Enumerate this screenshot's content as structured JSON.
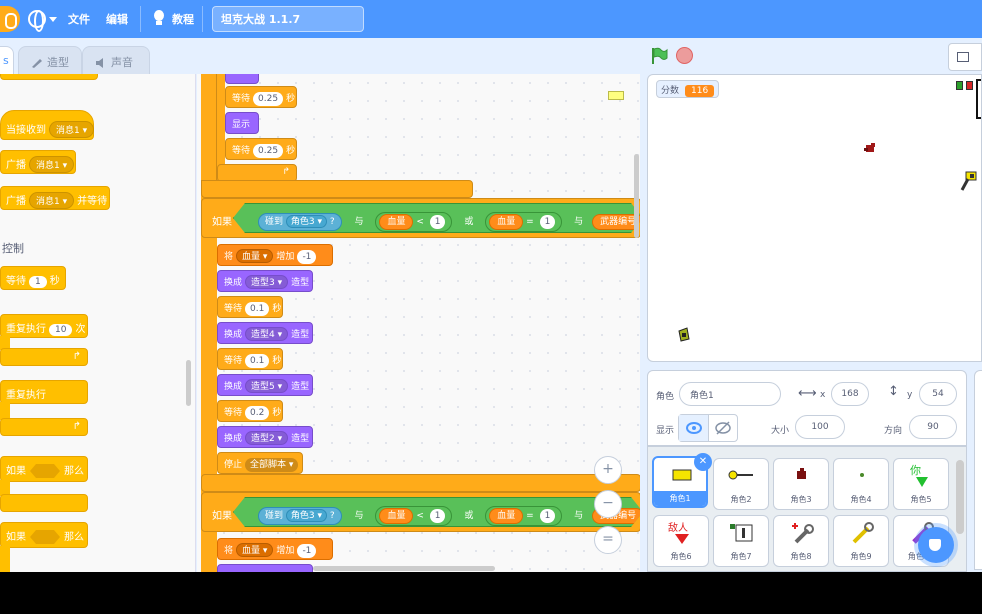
{
  "menubar": {
    "file_label": "文件",
    "edit_label": "编辑",
    "tutorials_label": "教程",
    "project_title": "坦克大战 1.1.7"
  },
  "tabs": {
    "code_label": "s",
    "costumes_label": "造型",
    "sounds_label": "声音"
  },
  "palette": {
    "when_receive": "当接收到",
    "when_receive_msg": "消息1",
    "broadcast": "广播",
    "broadcast_msg": "消息1",
    "broadcast_wait": "广播",
    "broadcast_wait_msg": "消息1",
    "broadcast_wait_suffix": "并等待",
    "category_control": "控制",
    "wait": "等待",
    "wait_value": "1",
    "wait_unit": "秒",
    "repeat": "重复执行",
    "repeat_value": "10",
    "repeat_unit": "次",
    "forever": "重复执行",
    "if_then_1_if": "如果",
    "if_then_1_then": "那么",
    "if_then_2_if": "如果",
    "if_then_2_then": "那么"
  },
  "script": {
    "top_wait1": "等待",
    "top_wait1_val": "0.25",
    "top_wait1_unit": "秒",
    "top_show": "显示",
    "top_wait2": "等待",
    "top_wait2_val": "0.25",
    "top_wait2_unit": "秒",
    "if1": {
      "if": "如果",
      "touching": "碰到",
      "touching_target": "角色3",
      "q": "?",
      "and1": "与",
      "hp1": "血量",
      "lt": "<",
      "lt_val": "1",
      "or": "或",
      "hp2": "血量",
      "eq": "=",
      "eq_val": "1",
      "and2": "与",
      "weapon": "武器编号"
    },
    "change_prefix": "将",
    "change_var": "血量",
    "change_mid": "增加",
    "change_val": "-1",
    "costume_switch": "换成",
    "costume_suffix": "造型",
    "costume3": "造型3",
    "costume4": "造型4",
    "costume5": "造型5",
    "costume2": "造型2",
    "wait": "等待",
    "wait_a": "0.1",
    "wait_b": "0.1",
    "wait_c": "0.2",
    "sec": "秒",
    "stop": "停止",
    "stop_opt": "全部脚本",
    "if2": {
      "if": "如果",
      "touching": "碰到",
      "touching_target": "角色3",
      "q": "?",
      "and1": "与",
      "hp1": "血量",
      "lt": "<",
      "lt_val": "1",
      "or": "或",
      "hp2": "血量",
      "eq": "=",
      "eq_val": "1",
      "and2": "与",
      "weapon": "武器编号"
    },
    "change2_prefix": "将",
    "change2_var": "血量",
    "change2_mid": "增加",
    "change2_val": "-1",
    "zoom_in": "+",
    "zoom_out": "−",
    "zoom_reset": "="
  },
  "stage": {
    "score_label": "分数",
    "score_value": "116"
  },
  "sprite_info": {
    "sprite_label": "角色",
    "sprite_name": "角色1",
    "x_label": "x",
    "x_value": "168",
    "y_label": "y",
    "y_value": "54",
    "show_label": "显示",
    "size_label": "大小",
    "size_value": "100",
    "direction_label": "方向",
    "direction_value": "90"
  },
  "sprites": [
    {
      "name": "角色1"
    },
    {
      "name": "角色2"
    },
    {
      "name": "角色3"
    },
    {
      "name": "角色4"
    },
    {
      "name": "角色5"
    },
    {
      "name": "角色6"
    },
    {
      "name": "角色7"
    },
    {
      "name": "角色8"
    },
    {
      "name": "角色9"
    },
    {
      "name": "角色10"
    }
  ],
  "colors": {
    "menubar": "#4c97ff",
    "control": "#ffab19",
    "looks": "#9966ff",
    "variables": "#ff8c1a",
    "operators": "#59c059",
    "sensing": "#5cb1d6"
  }
}
